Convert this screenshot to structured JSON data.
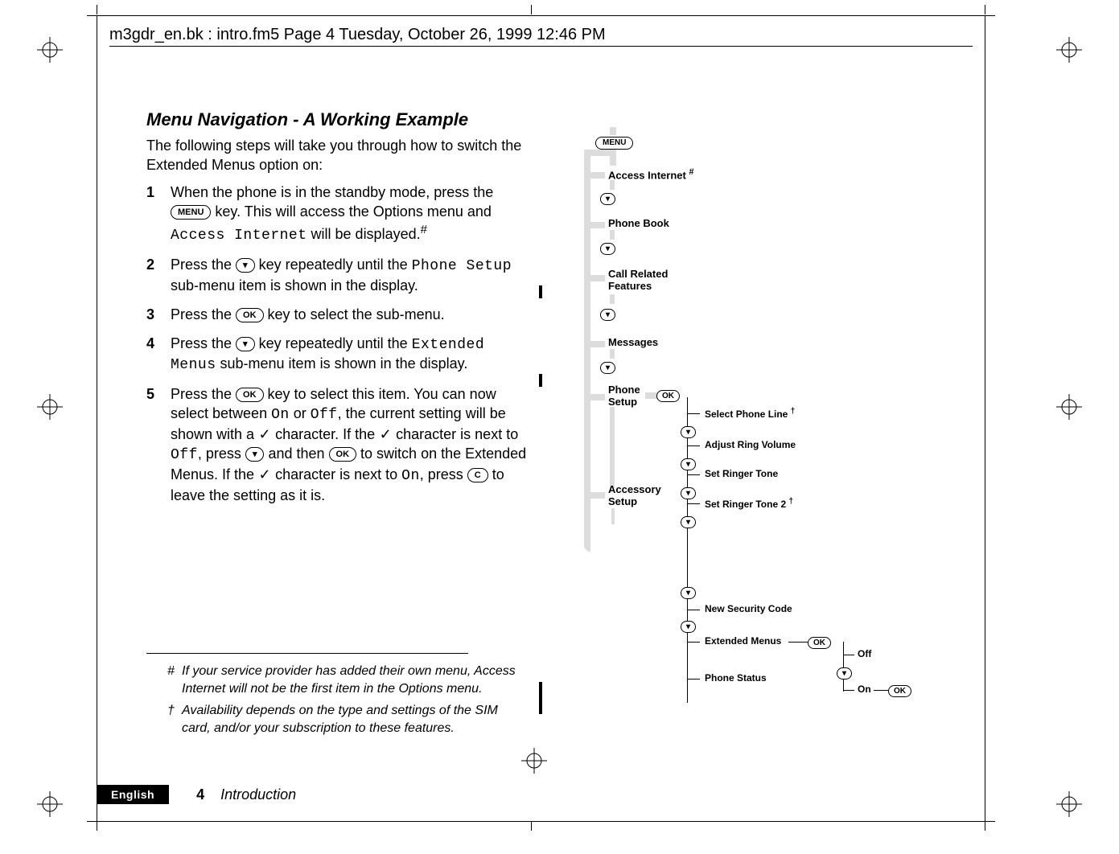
{
  "header_line": "m3gdr_en.bk : intro.fm5  Page 4  Tuesday, October 26, 1999  12:46 PM",
  "title": "Menu Navigation - A Working Example",
  "lead": "The following steps will take you through how to switch the Extended Menus option on:",
  "steps": [
    {
      "num": "1",
      "before": "When the phone is in the standby mode, press the ",
      "key": "MENU",
      "after_key": " key. This will access the Options menu and ",
      "mono": "Access Internet",
      "after_mono": " will be displayed.",
      "suffix": "#"
    },
    {
      "num": "2",
      "before": "Press the ",
      "key": "▾",
      "after_key": " key repeatedly until the ",
      "mono": "Phone Setup",
      "after_mono": " sub-menu item is shown in the display.",
      "suffix": ""
    },
    {
      "num": "3",
      "before": "Press the ",
      "key": "OK",
      "after_key": " key to select the sub-menu.",
      "mono": "",
      "after_mono": "",
      "suffix": ""
    },
    {
      "num": "4",
      "before": "Press the ",
      "key": "▾",
      "after_key": " key repeatedly until the ",
      "mono": "Extended Menus",
      "after_mono": " sub-menu item is shown in the display.",
      "suffix": ""
    },
    {
      "num": "5",
      "text_html": true
    }
  ],
  "step5": {
    "part1": "Press the ",
    "key1": "OK",
    "part2": " key to select this item. You can now select between ",
    "mono1": "On",
    "part3": " or ",
    "mono2": "Off",
    "part4": ", the current setting will be shown with a ",
    "chk": "✓",
    "part5": " character. If the ",
    "chk2": "✓",
    "part6": " character is next to ",
    "mono3": "Off",
    "part7": ", press ",
    "key2": "▾",
    "part8": " and then ",
    "key3": "OK",
    "part9": " to switch on the Extended Menus. If the ",
    "chk3": "✓",
    "part10": " character is next to ",
    "mono4": "On",
    "part11": ", press ",
    "key4": "C",
    "part12": " to leave the setting as it is."
  },
  "footnotes": [
    {
      "sym": "#",
      "text": "If your service provider has added their own menu, Access Internet will not be the first item in the Options menu."
    },
    {
      "sym": "†",
      "text": "Availability depends on the type and settings of the SIM card, and/or your subscription to these features."
    }
  ],
  "bottom": {
    "lang": "English",
    "page": "4",
    "section": "Introduction"
  },
  "diagram": {
    "menu_key": "MENU",
    "items": [
      {
        "label": "Access Internet",
        "suffix": "#"
      },
      {
        "label": "Phone Book"
      },
      {
        "label": "Call Related Features",
        "twoLine": true
      },
      {
        "label": "Messages"
      },
      {
        "label": "Phone Setup",
        "branch": true
      },
      {
        "label": "Accessory Setup"
      }
    ],
    "phone_setup_sub": [
      {
        "label": "Select Phone Line",
        "suffix": "†"
      },
      {
        "label": "Adjust Ring Volume"
      },
      {
        "label": "Set Ringer Tone"
      },
      {
        "label": "Set Ringer Tone 2",
        "suffix": "†"
      }
    ],
    "phone_setup_lower": [
      {
        "label": "New Security Code"
      },
      {
        "label": "Extended Menus",
        "hasOK": true
      },
      {
        "label": "Phone Status"
      }
    ],
    "ext_menu_opts": {
      "off": "Off",
      "on": "On"
    },
    "ok": "OK",
    "down": "▾"
  }
}
